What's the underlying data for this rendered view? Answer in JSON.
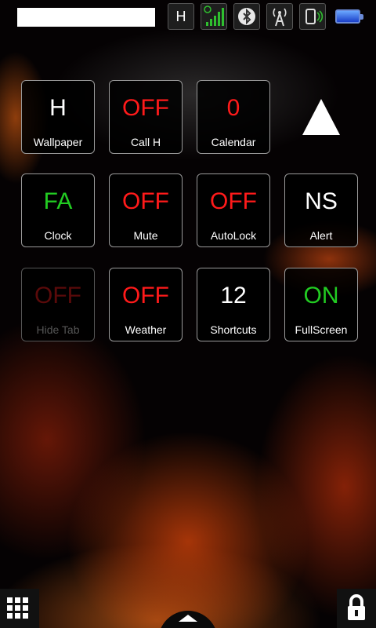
{
  "status": {
    "network_label": "H",
    "colors": {
      "signal": "#2fbf2f",
      "battery": "#2f5fe0"
    }
  },
  "icons": {
    "network": "network-type-icon",
    "signal": "signal-strength-icon",
    "bluetooth": "bluetooth-icon",
    "tower": "antenna-tower-icon",
    "vibrate": "vibrate-icon",
    "battery": "battery-icon",
    "up": "up-arrow-icon",
    "grid": "app-grid-icon",
    "lock": "lock-icon",
    "home": "home-chevron-icon"
  },
  "tiles": [
    {
      "value": "H",
      "label": "Wallpaper",
      "color": "#ffffff"
    },
    {
      "value": "OFF",
      "label": "Call H",
      "color": "#ff1a1a"
    },
    {
      "value": "0",
      "label": "Calendar",
      "color": "#ff1a1a"
    },
    {
      "value": "FA",
      "label": "Clock",
      "color": "#22cc22"
    },
    {
      "value": "OFF",
      "label": "Mute",
      "color": "#ff1a1a"
    },
    {
      "value": "OFF",
      "label": "AutoLock",
      "color": "#ff1a1a"
    },
    {
      "value": "NS",
      "label": "Alert",
      "color": "#ffffff"
    },
    {
      "value": "OFF",
      "label": "Hide Tab",
      "color": "#5a0a0a"
    },
    {
      "value": "OFF",
      "label": "Weather",
      "color": "#ff1a1a"
    },
    {
      "value": "12",
      "label": "Shortcuts",
      "color": "#ffffff"
    },
    {
      "value": "ON",
      "label": "FullScreen",
      "color": "#22cc22"
    }
  ]
}
